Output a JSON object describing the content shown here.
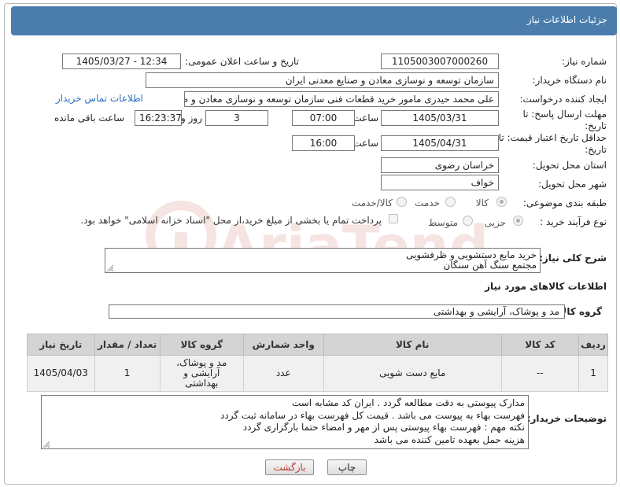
{
  "header": {
    "title": "جزئیات اطلاعات نیاز"
  },
  "fields": {
    "need_number": {
      "label": "شماره نیاز:",
      "value": "1105003007000260"
    },
    "announce_datetime": {
      "label": "تاریخ و ساعت اعلان عمومی:",
      "value": "1405/03/27 - 12:34"
    },
    "buyer_org": {
      "label": "نام دستگاه خریدار:",
      "value": "سازمان توسعه و نوسازی معادن و صنایع معدنی ایران"
    },
    "requester": {
      "label": "ایجاد کننده درخواست:",
      "value": "علی محمد حیدری مامور خرید قطعات فنی سازمان توسعه و نوسازی معادن و ص",
      "contact_link": "اطلاعات تماس خریدار"
    },
    "reply_deadline": {
      "label": "مهلت ارسال پاسخ: تا تاریخ:",
      "date": "1405/03/31",
      "time_label": "ساعت",
      "time": "07:00",
      "days": "3",
      "days_label": "روز و",
      "remaining": "16:23:37",
      "remaining_label": "ساعت باقی مانده"
    },
    "price_validity": {
      "label": "حداقل تاریخ اعتبار قیمت: تا تاریخ:",
      "date": "1405/04/31",
      "time_label": "ساعت",
      "time": "16:00"
    },
    "delivery_province": {
      "label": "استان محل تحویل:",
      "value": "خراسان رضوی"
    },
    "delivery_city": {
      "label": "شهر محل تحویل:",
      "value": "خواف"
    },
    "subject_category": {
      "label": "طبقه بندی موضوعی:",
      "options": [
        "کالا",
        "خدمت",
        "کالا/خدمت"
      ],
      "selected": "کالا"
    },
    "purchase_process": {
      "label": "نوع فرآیند خرید :",
      "options": [
        "جزیی",
        "متوسط"
      ],
      "selected": "جزیی",
      "payment_note": "پرداخت تمام یا بخشی از مبلغ خرید،از محل \"اسناد خزانه اسلامی\" خواهد بود."
    }
  },
  "description": {
    "label": "شرح کلی نیاز:",
    "line1": "خرید مایع دستشویی و ظرفشویی",
    "line2": "مجتمع سنگ آهن سنگان"
  },
  "goods_info": {
    "title": "اطلاعات کالاهای مورد نیاز"
  },
  "goods_group": {
    "label": "گروه کالا:",
    "value": "مد و پوشاک، آرایشی و بهداشتی"
  },
  "table": {
    "headers": [
      "ردیف",
      "کد کالا",
      "نام کالا",
      "واحد شمارش",
      "گروه کالا",
      "تعداد / مقدار",
      "تاریخ نیاز"
    ],
    "rows": [
      {
        "index": "1",
        "code": "--",
        "name": "مایع دست شویی",
        "unit": "عدد",
        "group_l1": "مد و پوشاک،",
        "group_l2": "آرایشی و",
        "group_l3": "بهداشتی",
        "qty": "1",
        "date": "1405/04/03"
      }
    ]
  },
  "buyer_notes": {
    "label": "توضیحات خریدار:",
    "lines": [
      "مدارک پیوستی به دقت مطالعه گردد . ایران کد مشابه است",
      "فهرست بهاء به پیوست می باشد . قیمت کل فهرست بهاء در سامانه ثبت گردد",
      "نکته مهم : فهرست بهاء پیوستی پس از مهر و امضاء حتما بارگزاری گردد",
      "هزینه حمل بعهده تامین کننده می باشد"
    ]
  },
  "buttons": {
    "print": "چاپ",
    "back": "بازگشت"
  },
  "watermark": {
    "text": "AriaTender.net"
  },
  "colors": {
    "header": "#4a7dac",
    "link": "#2a6fc2",
    "back_button_text": "#c0392b",
    "watermark": "#c0392b"
  }
}
